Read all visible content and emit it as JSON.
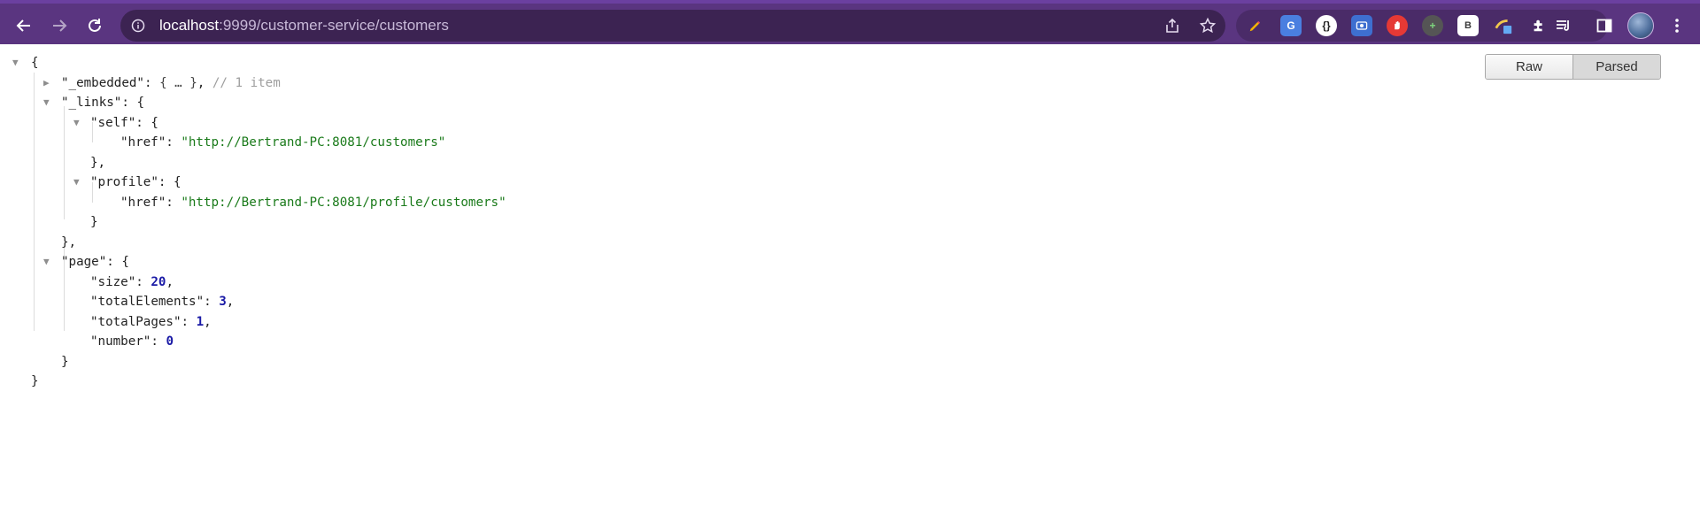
{
  "browser": {
    "url_host": "localhost",
    "url_path": ":9999/customer-service/customers",
    "extensions": [
      {
        "name": "pen-extension",
        "color": "#f4b400"
      },
      {
        "name": "google-translate-extension",
        "color": "#4a7fe0",
        "label": "G"
      },
      {
        "name": "json-extension",
        "color": "#ffffff",
        "label": "{}"
      },
      {
        "name": "screen-capture-extension",
        "color": "#3e6fd0"
      },
      {
        "name": "block-extension",
        "color": "#e53935"
      },
      {
        "name": "plus-extension",
        "color": "#4caf50",
        "label": "+"
      },
      {
        "name": "b-extension",
        "color": "#ffffff",
        "label": "B"
      },
      {
        "name": "color-picker-extension",
        "color": "#f2c94c"
      }
    ]
  },
  "view_toggle": {
    "raw_label": "Raw",
    "parsed_label": "Parsed",
    "active": "Parsed"
  },
  "json_view": {
    "open_brace": "{",
    "close_brace": "}",
    "embedded_key": "\"_embedded\"",
    "embedded_collapsed": "{ … }",
    "embedded_comment": "// 1 item",
    "links_key": "\"_links\"",
    "self_key": "\"self\"",
    "href_key": "\"href\"",
    "self_href": "\"http://Bertrand-PC:8081/customers\"",
    "profile_key": "\"profile\"",
    "profile_href": "\"http://Bertrand-PC:8081/profile/customers\"",
    "page_key": "\"page\"",
    "size_key": "\"size\"",
    "size_value": "20",
    "total_elements_key": "\"totalElements\"",
    "total_elements_value": "3",
    "total_pages_key": "\"totalPages\"",
    "total_pages_value": "1",
    "number_key": "\"number\"",
    "number_value": "0"
  }
}
